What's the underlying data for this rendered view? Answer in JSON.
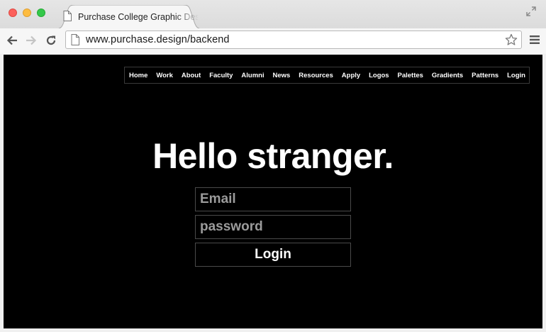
{
  "browser": {
    "tab_title": "Purchase College Graphic Design",
    "url": "www.purchase.design/backend",
    "icons": {
      "back": "arrow-left-icon",
      "forward": "arrow-right-icon",
      "reload": "reload-icon",
      "bookmark": "star-icon",
      "menu": "hamburger-menu-icon",
      "fullscreen": "fullscreen-icon",
      "page": "page-icon"
    }
  },
  "site": {
    "nav": [
      {
        "label": "Home"
      },
      {
        "label": "Work"
      },
      {
        "label": "About"
      },
      {
        "label": "Faculty"
      },
      {
        "label": "Alumni"
      },
      {
        "label": "News"
      },
      {
        "label": "Resources"
      },
      {
        "label": "Apply"
      },
      {
        "label": "Logos"
      },
      {
        "label": "Palettes"
      },
      {
        "label": "Gradients"
      },
      {
        "label": "Patterns"
      },
      {
        "label": "Login"
      }
    ],
    "heading": "Hello stranger.",
    "email_placeholder": "Email",
    "password_placeholder": "password",
    "login_label": "Login"
  },
  "colors": {
    "page_background": "#000000",
    "text": "#ffffff",
    "placeholder": "#9b9b9b",
    "field_border": "#4a4a4a"
  }
}
